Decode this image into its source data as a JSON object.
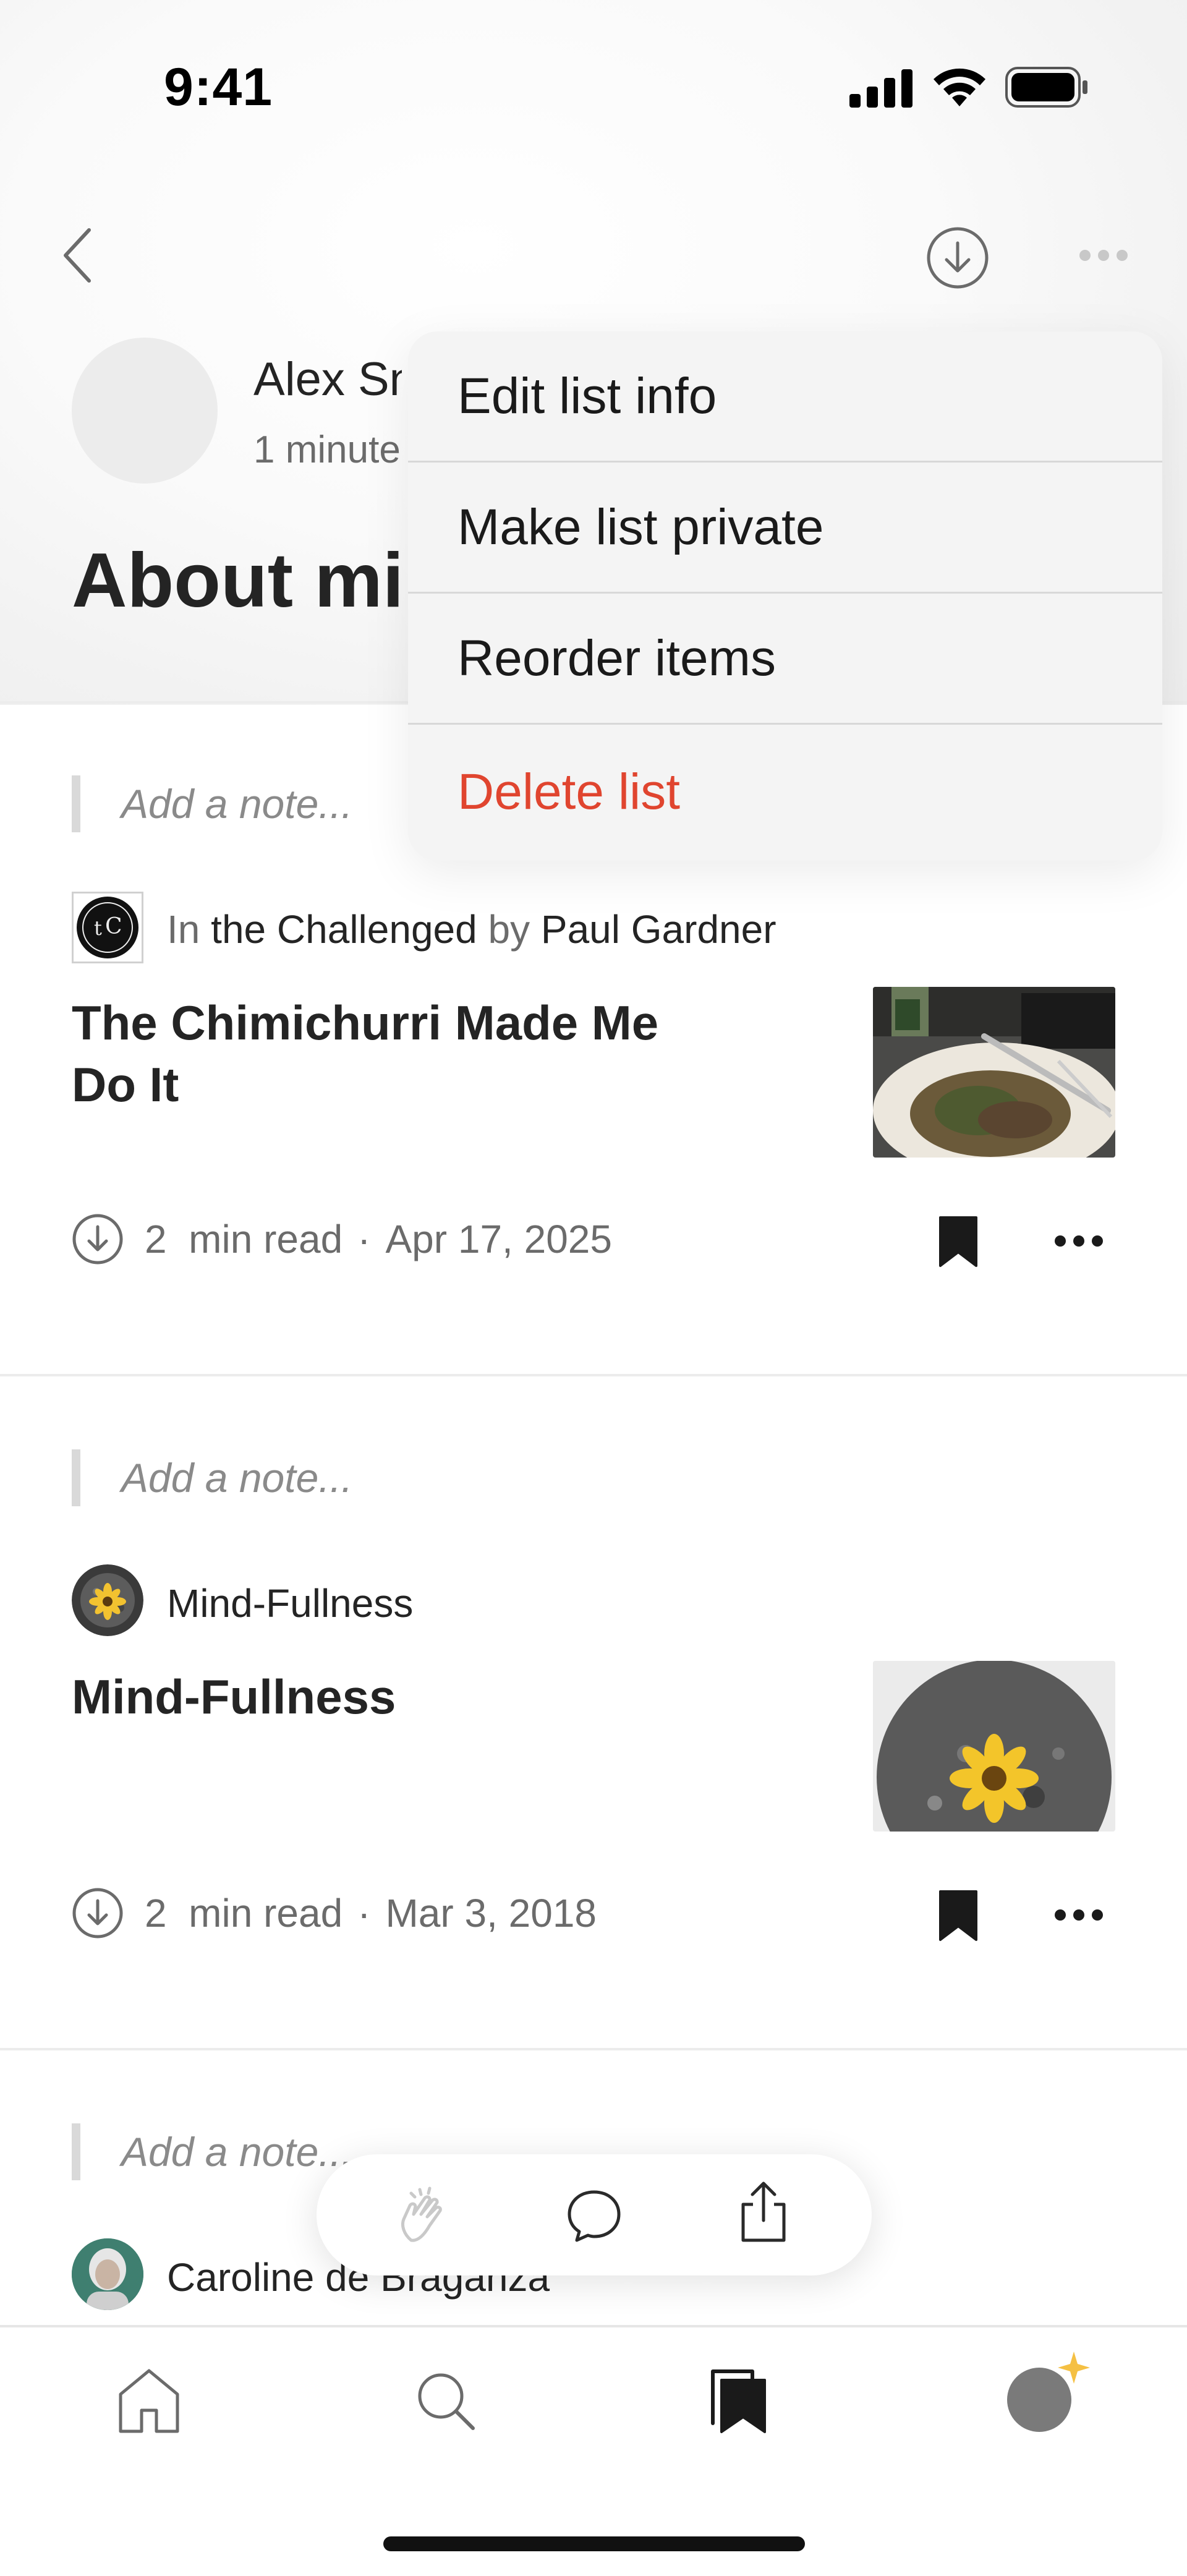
{
  "status_bar": {
    "time": "9:41"
  },
  "header": {
    "author_name": "Alex Sn",
    "author_meta": "1 minute",
    "list_title": "About min"
  },
  "menu": {
    "items": [
      {
        "label": "Edit list info"
      },
      {
        "label": "Make list private"
      },
      {
        "label": "Reorder items"
      },
      {
        "label": "Delete list"
      }
    ]
  },
  "items": [
    {
      "note_placeholder": "Add a note...",
      "in_word": "In",
      "publication": "the Challenged",
      "by_word": "by",
      "author": "Paul Gardner",
      "title": "The Chimichurri Made Me Do It",
      "read_time": "2  min read",
      "separator": "·",
      "date": "Apr 17, 2025"
    },
    {
      "note_placeholder": "Add a note...",
      "publication": "Mind-Fullness",
      "title": "Mind-Fullness",
      "read_time": "2  min read",
      "separator": "·",
      "date": "Mar 3, 2018"
    },
    {
      "note_placeholder": "Add a note...",
      "author": "Caroline de Braganza"
    }
  ],
  "icons": {
    "back": "chevron-left-icon",
    "download": "download-icon",
    "more": "more-horizontal-icon",
    "bookmark": "bookmark-filled-icon",
    "clap": "clap-icon",
    "comment": "comment-icon",
    "share": "share-icon",
    "home": "home-icon",
    "search": "search-icon",
    "library": "library-icon",
    "profile": "profile-avatar-icon"
  },
  "colors": {
    "danger": "#e0452f",
    "sparkle": "#f5c043",
    "text": "#242424",
    "muted": "#6b6b6b"
  }
}
